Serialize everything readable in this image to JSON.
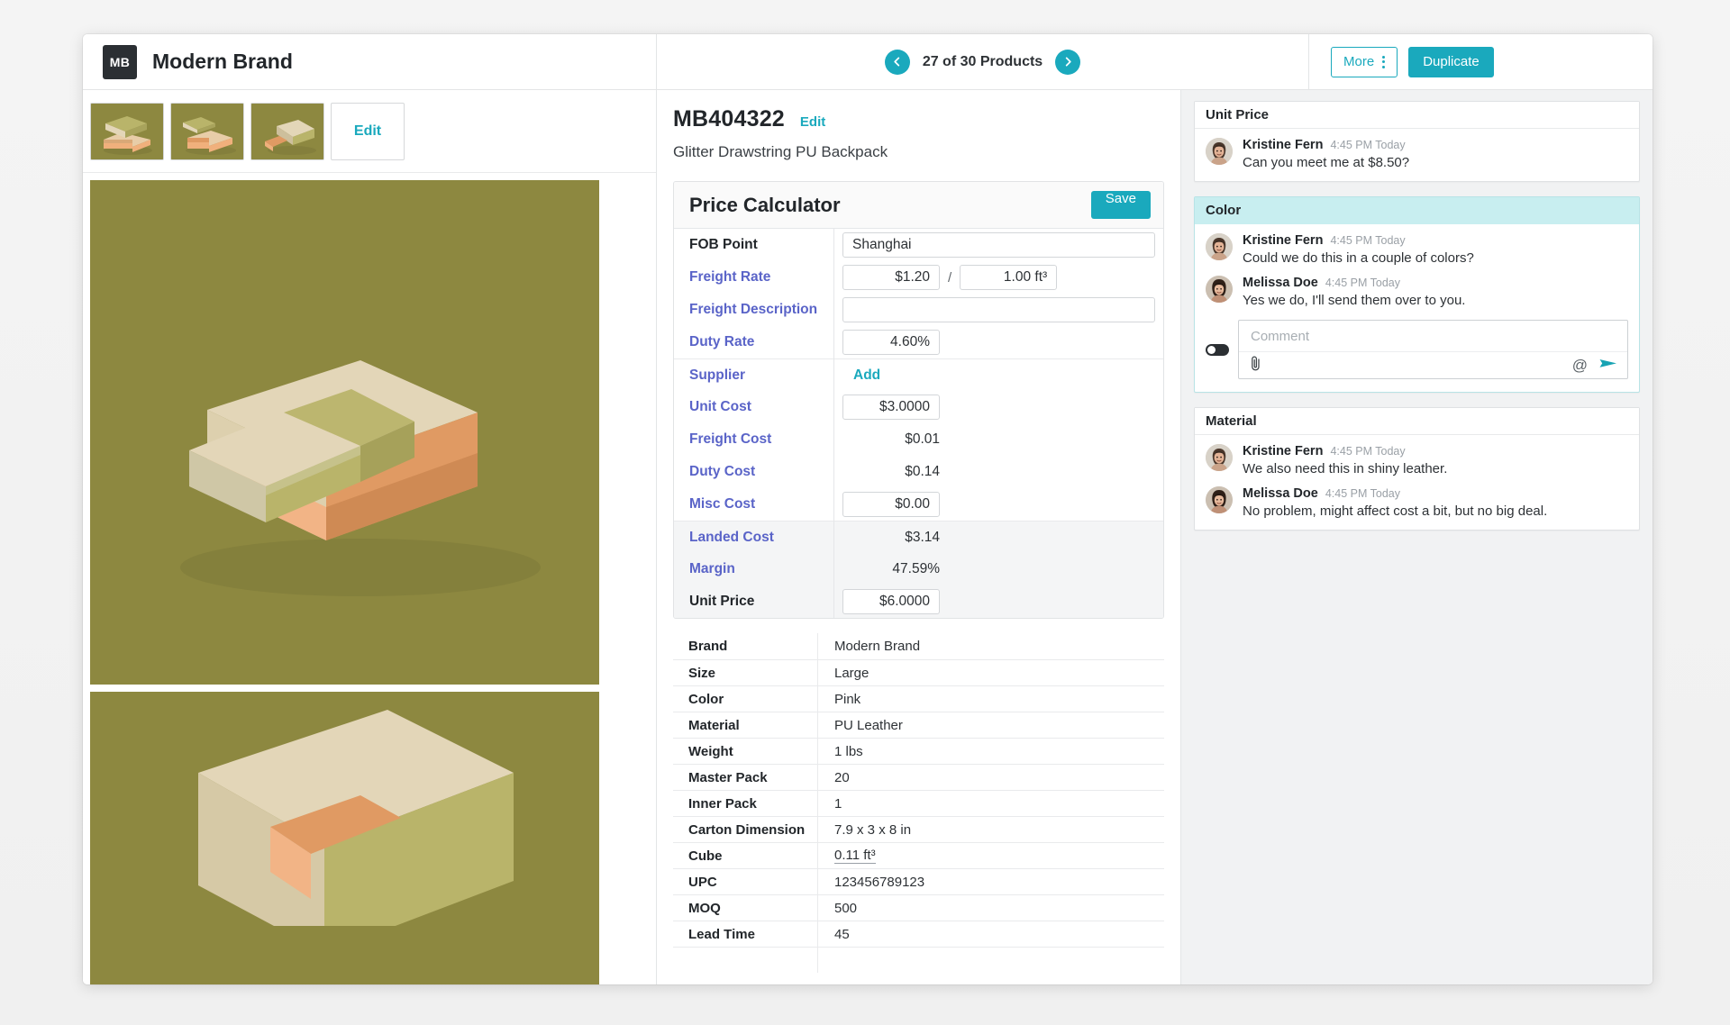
{
  "header": {
    "logo_initials": "MB",
    "brand_name": "Modern Brand",
    "pager_label": "27 of 30 Products",
    "prev_icon": "chevron-left-icon",
    "next_icon": "chevron-right-icon",
    "more_label": "More",
    "duplicate_label": "Duplicate"
  },
  "media": {
    "thumbnails": [
      "product-thumbnail-1",
      "product-thumbnail-2",
      "product-thumbnail-3"
    ],
    "edit_label": "Edit"
  },
  "product": {
    "sku": "MB404322",
    "edit_label": "Edit",
    "name": "Glitter Drawstring PU Backpack"
  },
  "calculator": {
    "title": "Price Calculator",
    "save_label": "Save",
    "rows": [
      {
        "label": "FOB Point",
        "value": "Shanghai",
        "kind": "input-wide",
        "bold": true
      },
      {
        "label": "Freight Rate",
        "value": "$1.20",
        "value2": "1.00 ft³",
        "separator": "/",
        "kind": "input-split"
      },
      {
        "label": "Freight Description",
        "value": "",
        "kind": "input-wide"
      },
      {
        "label": "Duty Rate",
        "value": "4.60%",
        "kind": "input-num"
      },
      {
        "label": "Supplier",
        "value": "Add",
        "kind": "link"
      },
      {
        "label": "Unit Cost",
        "value": "$3.0000",
        "kind": "input-num"
      },
      {
        "label": "Freight Cost",
        "value": "$0.01",
        "kind": "text"
      },
      {
        "label": "Duty Cost",
        "value": "$0.14",
        "kind": "text"
      },
      {
        "label": "Misc Cost",
        "value": "$0.00",
        "kind": "input-num"
      },
      {
        "label": "Landed Cost",
        "value": "$3.14",
        "kind": "text",
        "band": true
      },
      {
        "label": "Margin",
        "value": "47.59%",
        "kind": "text",
        "band": true
      },
      {
        "label": "Unit Price",
        "value": "$6.0000",
        "kind": "input-num",
        "band": true,
        "bold": true
      }
    ]
  },
  "attributes": [
    {
      "key": "Brand",
      "value": "Modern Brand"
    },
    {
      "key": "Size",
      "value": "Large"
    },
    {
      "key": "Color",
      "value": "Pink"
    },
    {
      "key": "Material",
      "value": "PU Leather"
    },
    {
      "key": "Weight",
      "value": "1 lbs"
    },
    {
      "key": "Master Pack",
      "value": "20"
    },
    {
      "key": "Inner Pack",
      "value": "1"
    },
    {
      "key": "Carton Dimension",
      "value": "7.9 x 3 x 8 in"
    },
    {
      "key": "Cube",
      "value": "0.11 ft³",
      "underlined": true
    },
    {
      "key": "UPC",
      "value": "123456789123"
    },
    {
      "key": "MOQ",
      "value": "500"
    },
    {
      "key": "Lead Time",
      "value": "45"
    }
  ],
  "comments": {
    "threads": [
      {
        "title": "Unit Price",
        "active": false,
        "messages": [
          {
            "name": "Kristine Fern",
            "time": "4:45 PM Today",
            "text": "Can you meet me at $8.50?",
            "avatar": "avatar-kristine"
          }
        ],
        "composer": false
      },
      {
        "title": "Color",
        "active": true,
        "messages": [
          {
            "name": "Kristine Fern",
            "time": "4:45 PM Today",
            "text": "Could we do this in a couple of colors?",
            "avatar": "avatar-kristine"
          },
          {
            "name": "Melissa Doe",
            "time": "4:45 PM Today",
            "text": "Yes we do, I'll send them over to you.",
            "avatar": "avatar-melissa"
          }
        ],
        "composer": true
      },
      {
        "title": "Material",
        "active": false,
        "messages": [
          {
            "name": "Kristine Fern",
            "time": "4:45 PM Today",
            "text": "We also need this in shiny leather.",
            "avatar": "avatar-kristine"
          },
          {
            "name": "Melissa Doe",
            "time": "4:45 PM Today",
            "text": "No problem, might affect cost a bit, but no big deal.",
            "avatar": "avatar-melissa"
          }
        ],
        "composer": false
      }
    ],
    "composer": {
      "placeholder": "Comment",
      "attach_icon": "paperclip-icon",
      "mention_icon": "at-mention-icon",
      "send_icon": "send-icon",
      "toggle_icon": "privacy-toggle"
    }
  },
  "colors": {
    "accent": "#1aa9bd",
    "label_blue": "#5a64c8",
    "active_thread": "#c8eef0",
    "product_bg": "#8d8840",
    "logo_bg": "#2b2f33"
  }
}
